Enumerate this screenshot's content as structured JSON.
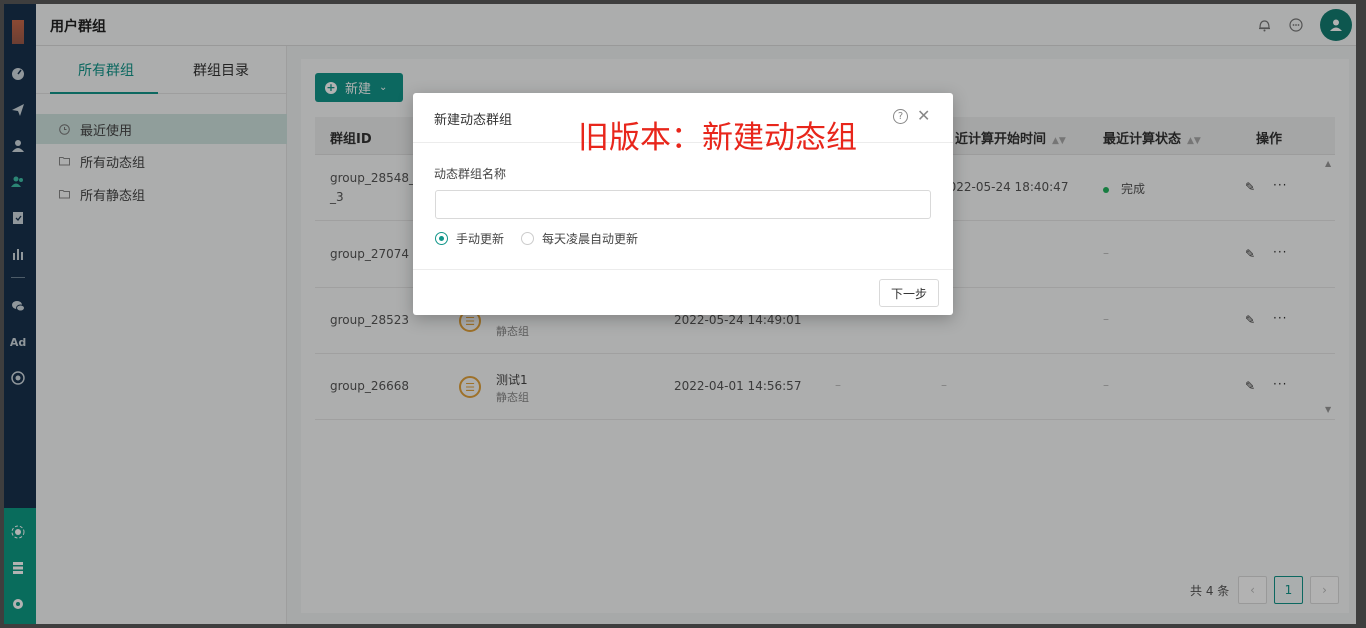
{
  "header": {
    "title": "用户群组"
  },
  "sidenav": {
    "tabs": [
      {
        "label": "所有群组"
      },
      {
        "label": "群组目录"
      }
    ],
    "items": [
      {
        "label": "最近使用"
      },
      {
        "label": "所有动态组"
      },
      {
        "label": "所有静态组"
      }
    ]
  },
  "rail": {
    "ad_label": "Ad"
  },
  "toolbar": {
    "new_label": "新建",
    "plus": "+",
    "caret": "⌄"
  },
  "table": {
    "columns": {
      "group_id": "群组ID",
      "calc_start": "近计算开始时间",
      "calc_status": "最近计算状态",
      "actions": "操作",
      "sort_glyph": "▲▼"
    },
    "rows": [
      {
        "group_id_line1": "group_28548_c",
        "group_id_line2": "_3",
        "time": "2022-05-24 18:40:47",
        "status": "完成"
      },
      {
        "group_id_line1": "group_27074",
        "col_b": "–"
      },
      {
        "group_id_line1": "group_28523",
        "group_type": "静态组",
        "time": "2022-05-24 14:49:01",
        "col_b": "–"
      },
      {
        "group_id_line1": "group_26668",
        "group_name": "测试1",
        "group_type": "静态组",
        "time": "2022-04-01 14:56:57",
        "col_a": "–",
        "col_c": "–",
        "col_b": "–"
      }
    ],
    "edit_glyph": "✎",
    "more_glyph": "···"
  },
  "pagination": {
    "total": "共 4 条",
    "current": "1",
    "prev": "‹",
    "next": "›"
  },
  "modal": {
    "title": "新建动态群组",
    "name_label": "动态群组名称",
    "name_value": "",
    "radio_manual": "手动更新",
    "radio_auto": "每天凌晨自动更新",
    "next_button": "下一步",
    "help_glyph": "?",
    "close_glyph": "✕"
  },
  "annotation": "旧版本：新建动态组",
  "colors": {
    "accent": "#12968a",
    "rail": "#17324d",
    "annotation": "#e8261b",
    "status_ok": "#22b35e",
    "list_icon": "#e2a23b"
  }
}
